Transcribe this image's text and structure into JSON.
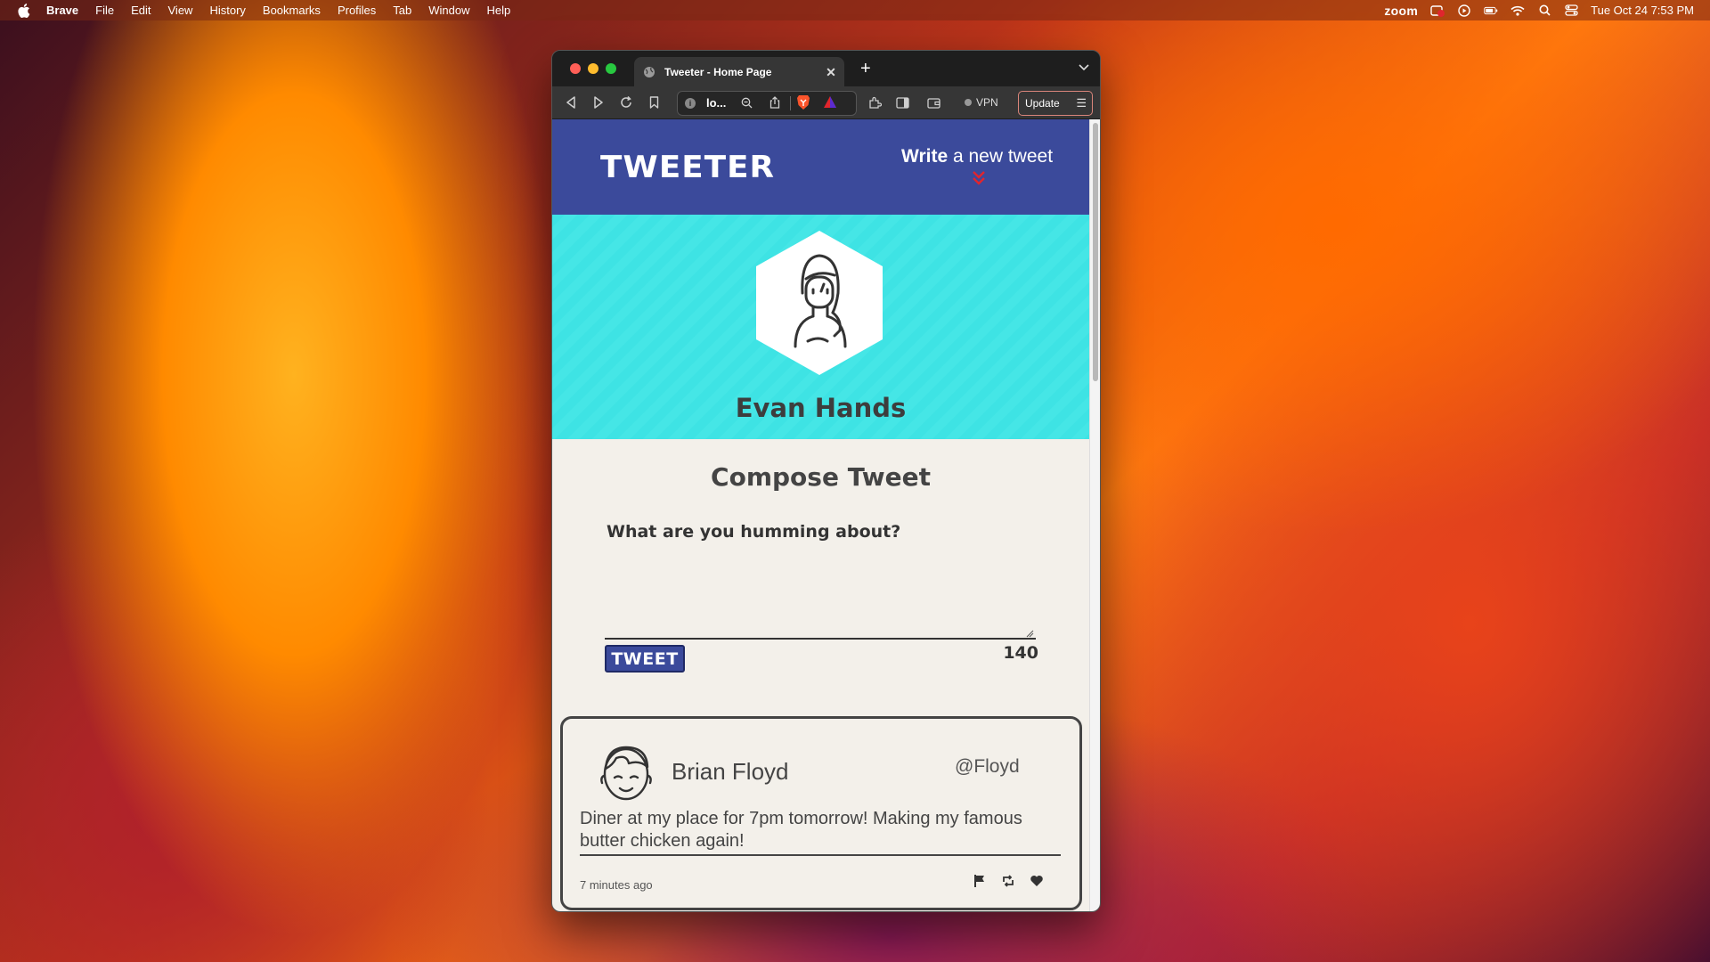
{
  "menubar": {
    "app": "Brave",
    "items": [
      "File",
      "Edit",
      "View",
      "History",
      "Bookmarks",
      "Profiles",
      "Tab",
      "Window",
      "Help"
    ],
    "zoom_label": "zoom",
    "clock": "Tue Oct 24  7:53 PM"
  },
  "browser": {
    "tab_title": "Tweeter - Home Page",
    "url": "lo...",
    "vpn_label": "VPN",
    "update_label": "Update"
  },
  "page": {
    "logo": "TWEETER",
    "write_bold": "Write",
    "write_rest": " a new tweet",
    "profile_name": "Evan Hands",
    "compose_title": "Compose Tweet",
    "prompt": "What are you humming about?",
    "tweet_button": "TWEET",
    "char_counter": "140",
    "tweets": [
      {
        "name": "Brian Floyd",
        "handle": "@Floyd",
        "content": "Diner at my place for 7pm tomorrow! Making my famous butter chicken again!",
        "time": "7 minutes ago"
      }
    ]
  },
  "colors": {
    "nav": "#3b4a9b",
    "profile_bg": "#3ee3e4",
    "page_bg": "#f3f0ea",
    "chevron": "#e0252e"
  }
}
